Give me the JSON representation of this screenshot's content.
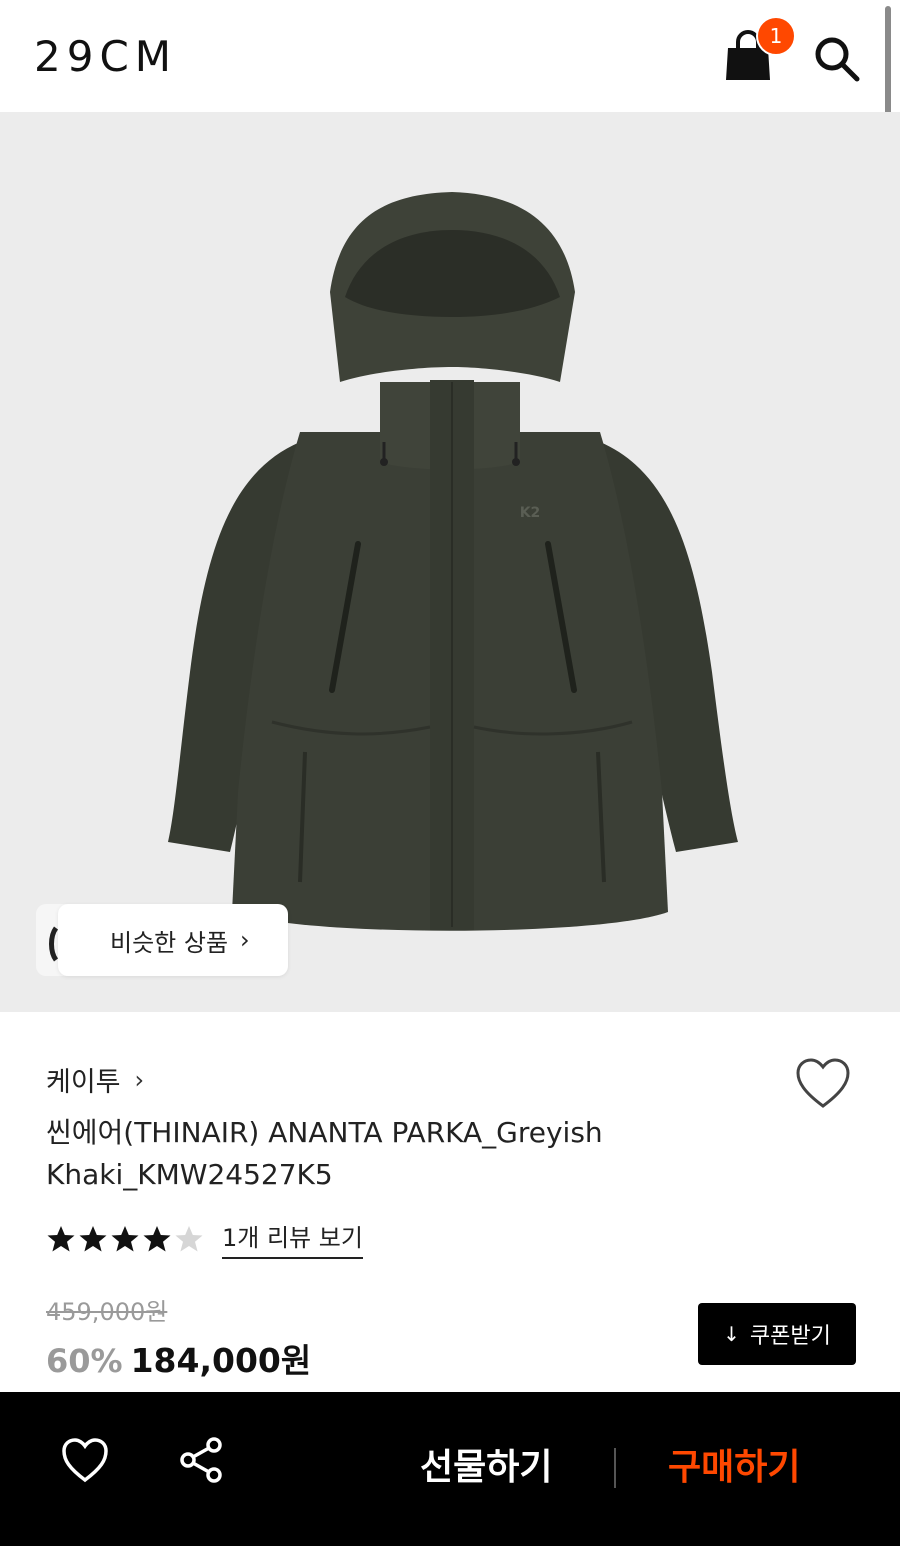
{
  "header": {
    "logo": "29CM",
    "cart_count": "1"
  },
  "similar": {
    "label": "비슷한 상품",
    "chevron": "›"
  },
  "product": {
    "brand": "케이투",
    "brand_chevron": "›",
    "title": "씬에어(THINAIR) ANANTA PARKA_Greyish Khaki_KMW24527K5",
    "rating": 4,
    "rating_max": 5,
    "review_link": "1개 리뷰 보기",
    "original_price": "459,000원",
    "discount": "60%",
    "sale_price": "184,000원",
    "coupon_label": "쿠폰받기",
    "coupon_icon": "↓",
    "jacket_logo": "K2"
  },
  "bottom_bar": {
    "gift_label": "선물하기",
    "buy_label": "구매하기"
  },
  "colors": {
    "accent": "#ff4800",
    "jacket": "#3b3f36",
    "image_bg": "#ececec"
  },
  "icons": [
    "cart-icon",
    "search-icon",
    "heart-icon",
    "share-icon",
    "chevron-right-icon",
    "download-icon",
    "star-icon"
  ]
}
